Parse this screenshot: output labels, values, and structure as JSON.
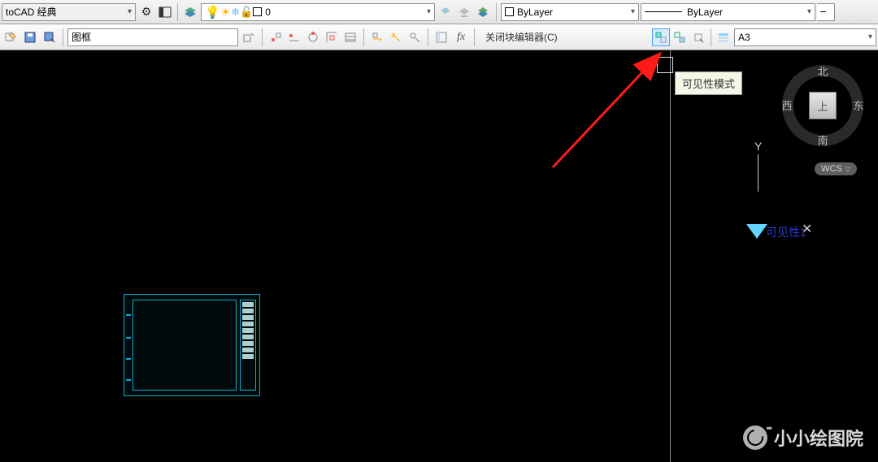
{
  "top": {
    "workspace": "toCAD 经典",
    "layer_value": "0",
    "color_value": "ByLayer",
    "linetype_value": "ByLayer"
  },
  "row2": {
    "block_name": "图框",
    "close_editor_label": "关闭块编辑器(C)",
    "fx_label": "fx",
    "paper_value": "A3"
  },
  "tooltip": {
    "text": "可见性模式"
  },
  "compass": {
    "n": "北",
    "s": "南",
    "e": "东",
    "w": "西",
    "top": "上"
  },
  "wcs": {
    "label": "WCS"
  },
  "ucs": {
    "y": "Y",
    "x": "✕",
    "vis_label": "可见性1"
  },
  "watermark": {
    "text": "小小绘图院"
  }
}
